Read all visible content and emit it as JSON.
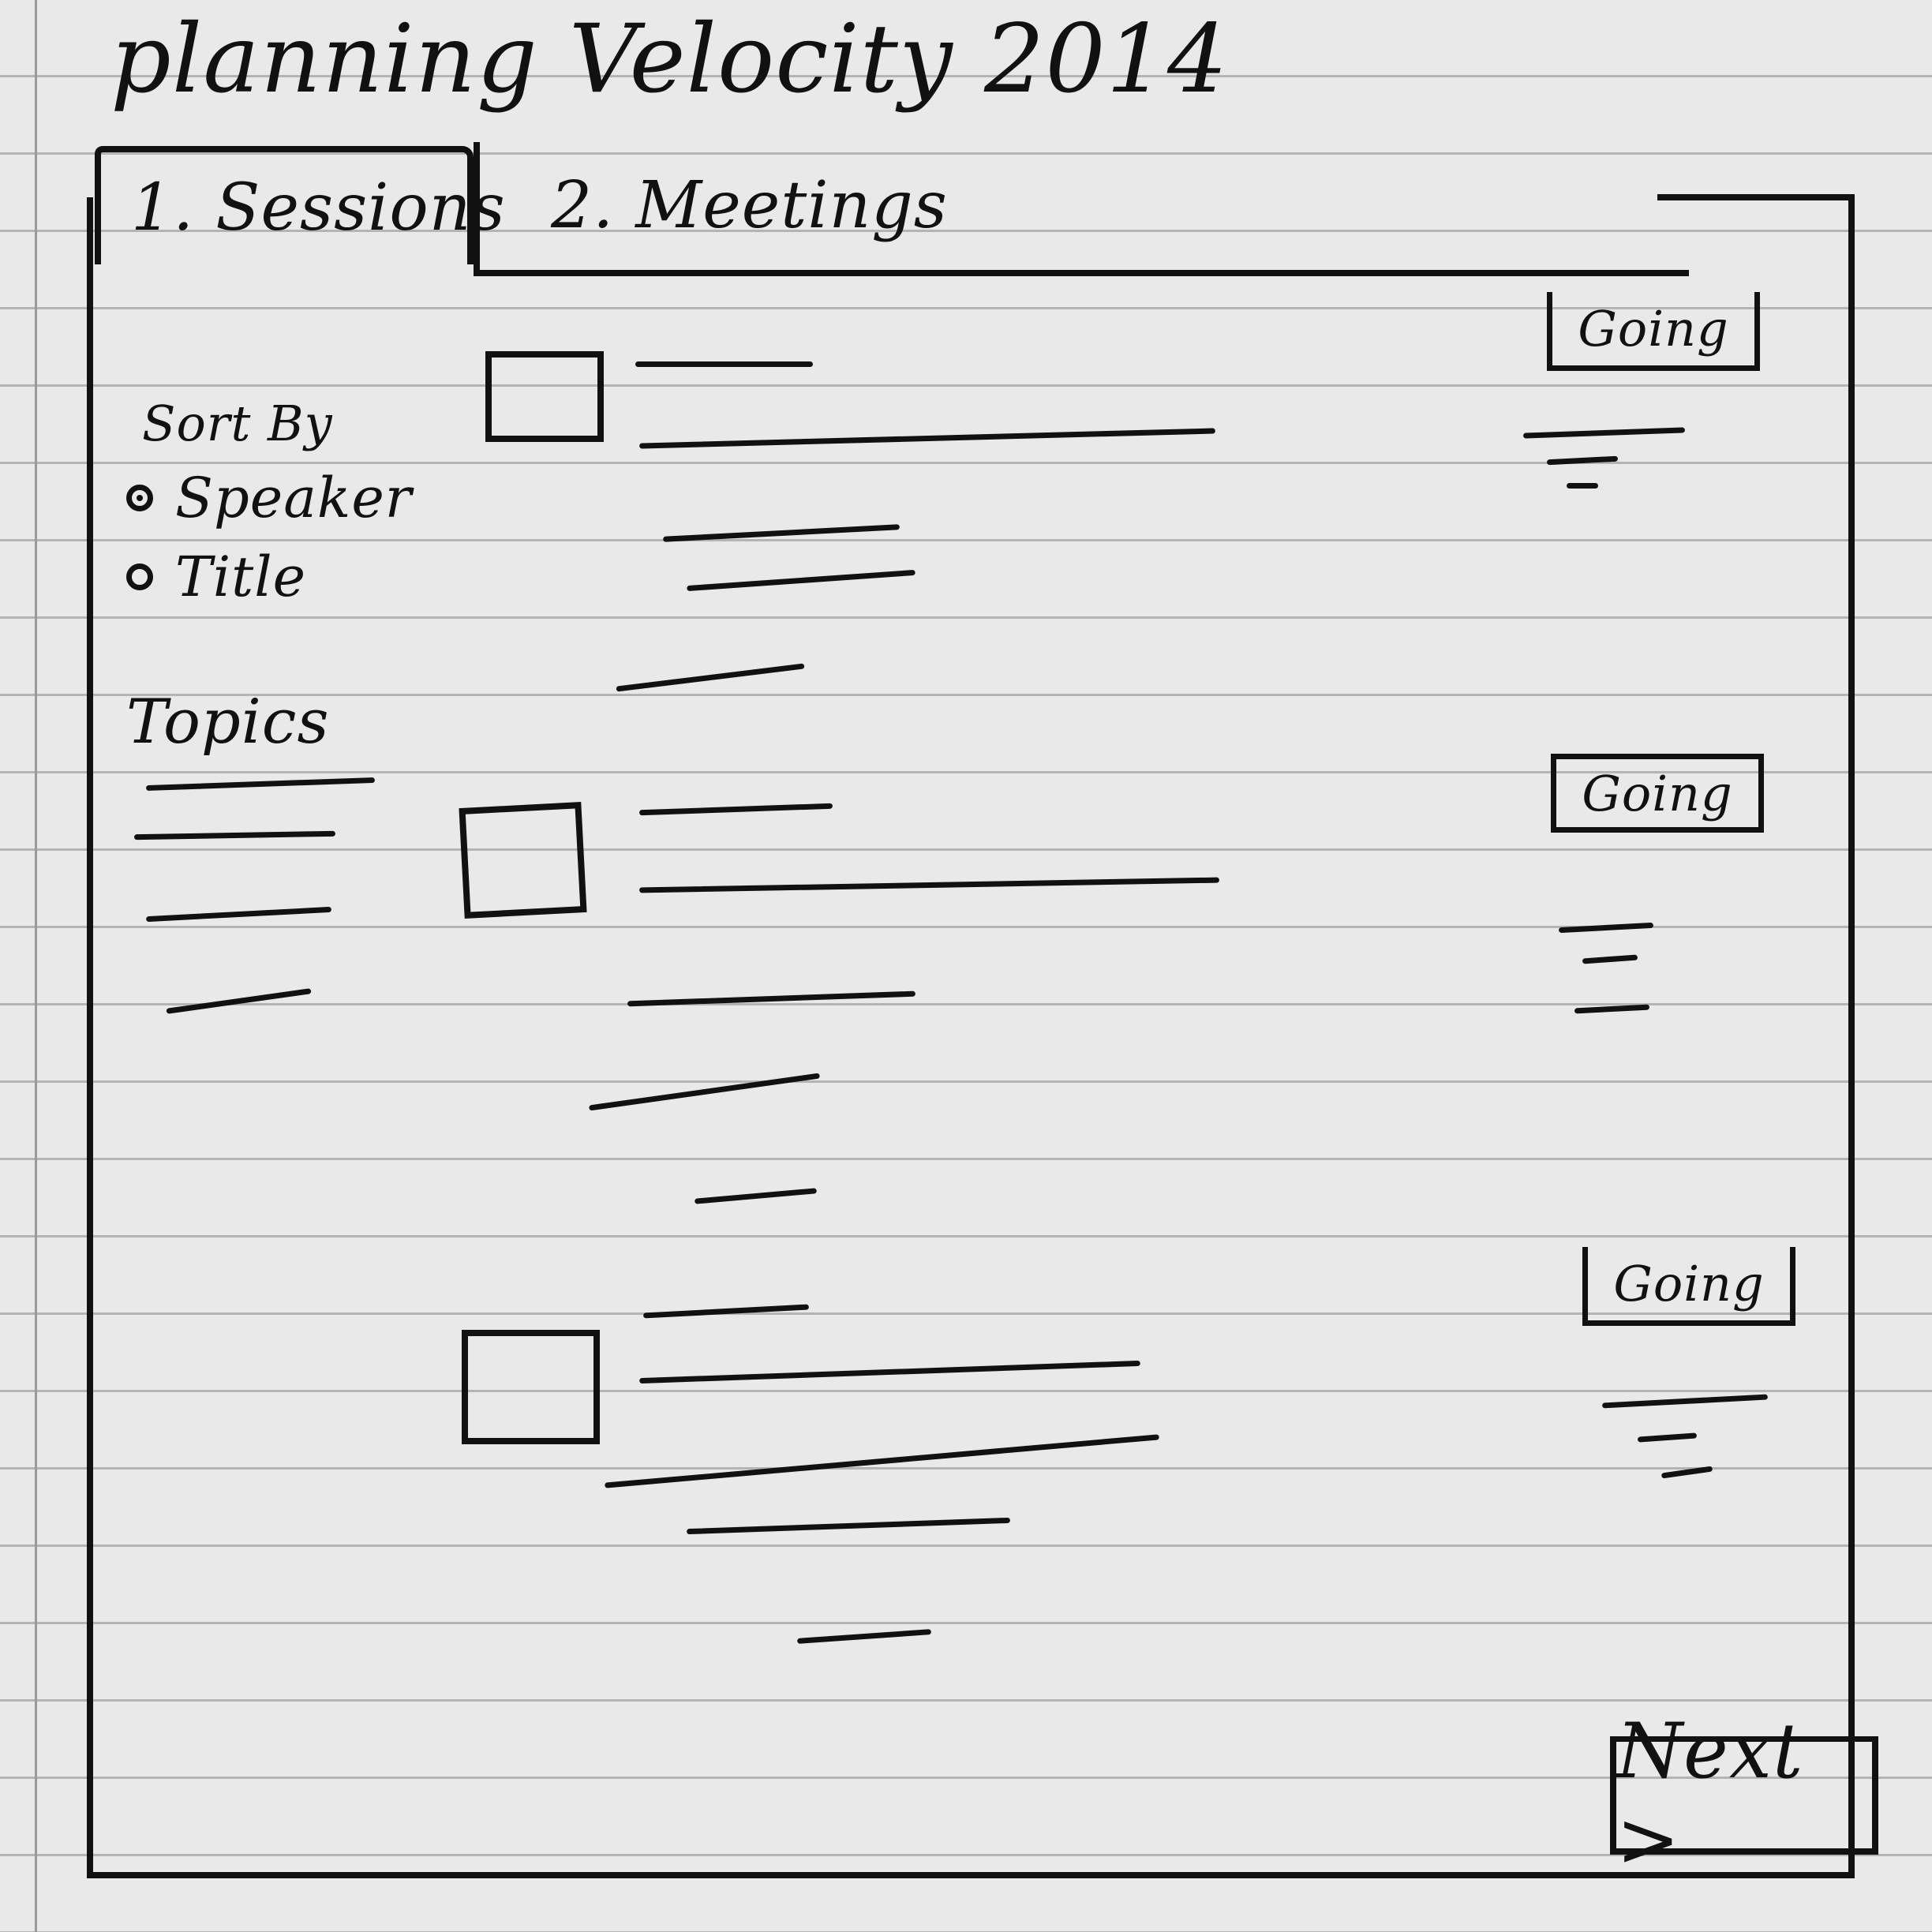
{
  "app": {
    "title": "planning Velocity 2014"
  },
  "tabs": [
    {
      "label": "1. Sessions",
      "active": true
    },
    {
      "label": "2. Meetings",
      "active": false
    }
  ],
  "sidebar": {
    "sort_by_label": "Sort By",
    "sort_options": [
      {
        "label": "Speaker",
        "checked": true
      },
      {
        "label": "Title",
        "checked": false
      }
    ],
    "topics_label": "Topics"
  },
  "sessions": [
    {
      "going_label": "Going"
    },
    {
      "going_label": "Going"
    },
    {
      "going_label": "Going"
    }
  ],
  "footer": {
    "next_label": "Next >"
  }
}
